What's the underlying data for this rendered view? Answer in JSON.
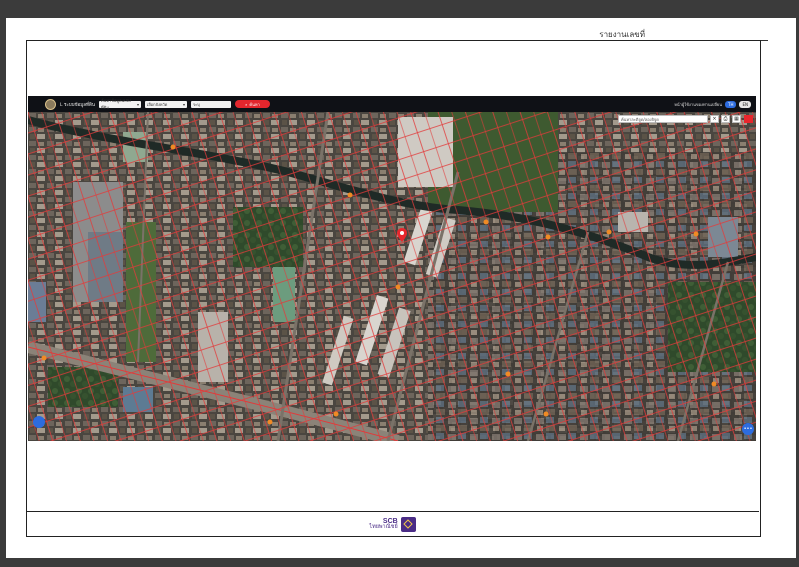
{
  "report": {
    "report_number_label": "รายงานเลขที่",
    "report_number_value": ""
  },
  "footer": {
    "brand_short": "SCB",
    "brand_thai": "ไทยพาณิชย์"
  },
  "map_app": {
    "site_title": "L ระบบข้อมูลที่ดิน",
    "select_1": "ค้นหาข้อมูลแปลงที่ดิน",
    "select_2": "เลือกจังหวัด",
    "input_placeholder": "ระบุ",
    "search_button": "ค้นหา",
    "top_link": "หน้าผู้ใช้งานของท่านเปลี่ยน",
    "lang_th": "TH",
    "lang_en": "EN",
    "coord_placeholder": "ค้นหาละติจูด/ลองจิจูด",
    "layers_label": "•••"
  },
  "colors": {
    "topbar": "#0f1116",
    "parcel_line": "#e23a3a",
    "search_btn": "#e3262d",
    "brand_purple": "#4a2c86"
  }
}
